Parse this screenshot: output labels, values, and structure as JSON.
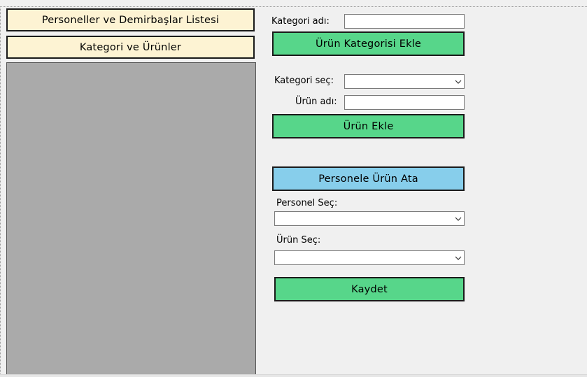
{
  "nav": {
    "personnel_list": "Personeller ve Demirbaşlar Listesi",
    "categories_products": "Kategori ve Ürünler"
  },
  "category_form": {
    "name_label": "Kategori adı:",
    "name_value": "",
    "add_button": "Ürün Kategorisi Ekle"
  },
  "product_form": {
    "category_label": "Kategori seç:",
    "category_value": "",
    "name_label": "Ürün adı:",
    "name_value": "",
    "add_button": "Ürün Ekle"
  },
  "assign_form": {
    "header_button": "Personele Ürün Ata",
    "personnel_label": "Personel Seç:",
    "personnel_value": "",
    "product_label": "Ürün Seç:",
    "product_value": "",
    "save_button": "Kaydet"
  },
  "colors": {
    "nav_button_bg": "#fdf3d3",
    "action_green": "#57d68a",
    "assign_blue": "#87ceeb",
    "panel_gray": "#aaaaaa",
    "window_bg": "#f0f0f0"
  },
  "icons": {
    "dropdown": "chevron-down-icon"
  }
}
